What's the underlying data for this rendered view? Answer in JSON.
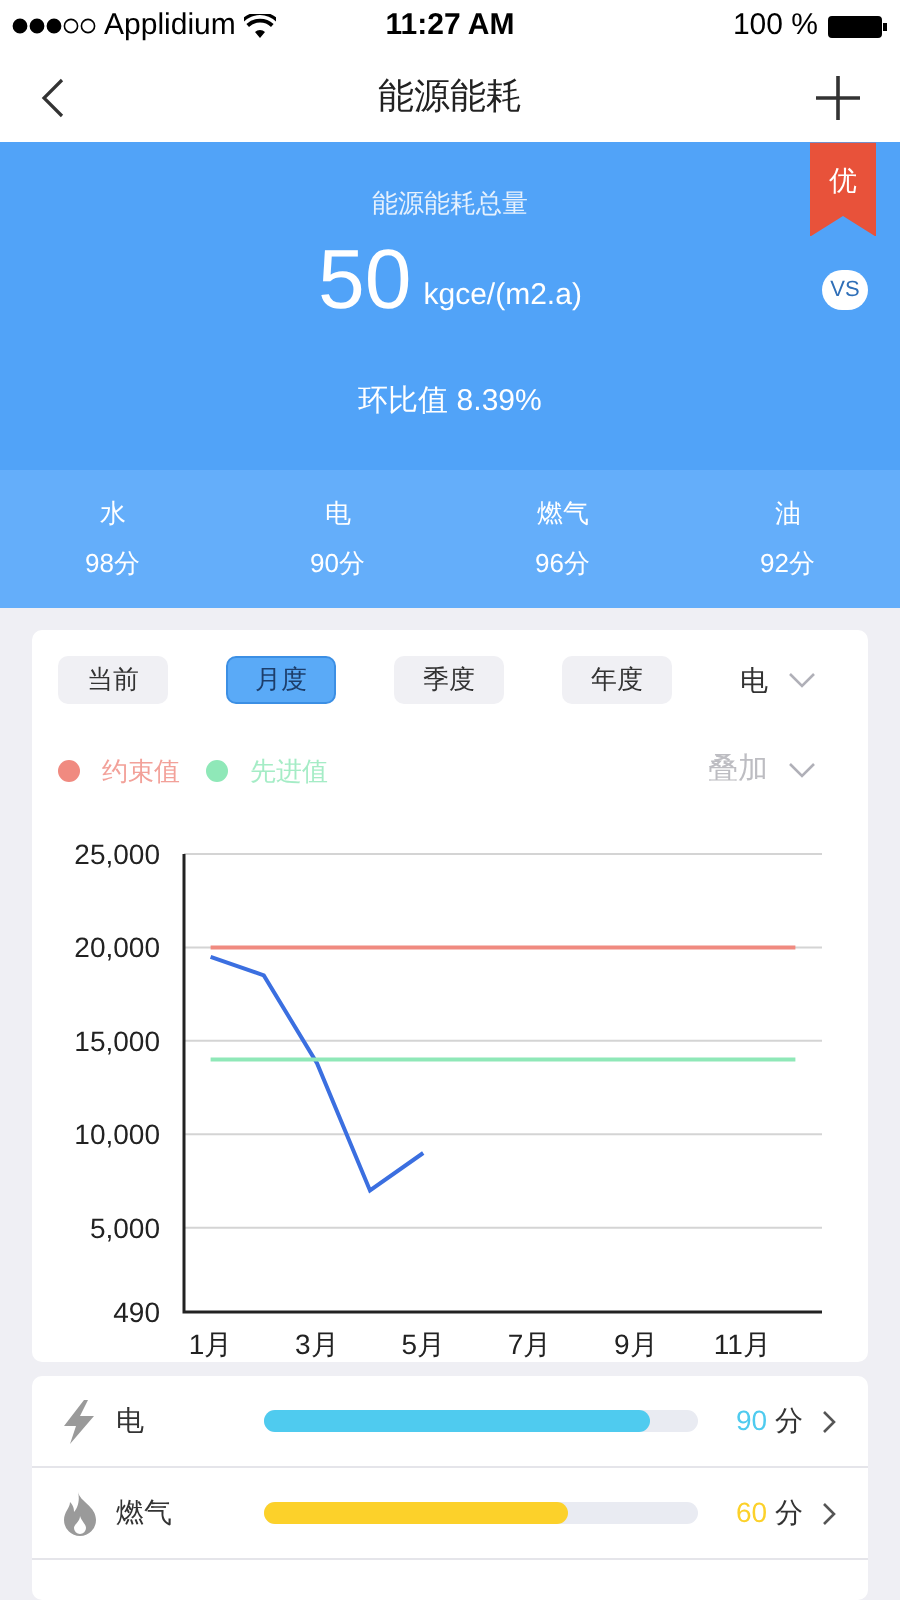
{
  "status_bar": {
    "carrier": "Applidium",
    "time": "11:27 AM",
    "battery": "100 %"
  },
  "nav": {
    "title": "能源能耗"
  },
  "summary": {
    "title": "能源能耗总量",
    "value": "50",
    "unit": "kgce/(m2.a)",
    "ratio": "环比值 8.39%",
    "badge": "优",
    "compare": "VS"
  },
  "scores": [
    {
      "label": "水",
      "value": "98分"
    },
    {
      "label": "电",
      "value": "90分"
    },
    {
      "label": "燃气",
      "value": "96分"
    },
    {
      "label": "油",
      "value": "92分"
    }
  ],
  "period_tabs": [
    {
      "label": "当前",
      "selected": false
    },
    {
      "label": "月度",
      "selected": true
    },
    {
      "label": "季度",
      "selected": false
    },
    {
      "label": "年度",
      "selected": false
    }
  ],
  "energy_select": {
    "value": "电"
  },
  "overlay_select": {
    "value": "叠加"
  },
  "chart_data": {
    "type": "line",
    "x": [
      1,
      2,
      3,
      4,
      5,
      6,
      7,
      8,
      9,
      10,
      11,
      12
    ],
    "grid": true,
    "xlim": [
      0.5,
      12.5
    ],
    "ylim": [
      490,
      25000
    ],
    "xticks": [
      {
        "value": 1,
        "label": "1月"
      },
      {
        "value": 3,
        "label": "3月"
      },
      {
        "value": 5,
        "label": "5月"
      },
      {
        "value": 7,
        "label": "7月"
      },
      {
        "value": 9,
        "label": "9月"
      },
      {
        "value": 11,
        "label": "11月"
      }
    ],
    "yticks": [
      {
        "value": 25000,
        "label": "25,000"
      },
      {
        "value": 20000,
        "label": "20,000"
      },
      {
        "value": 15000,
        "label": "15,000"
      },
      {
        "value": 10000,
        "label": "10,000"
      },
      {
        "value": 5000,
        "label": "5,000"
      },
      {
        "value": 490,
        "label": "490"
      }
    ],
    "series": [
      {
        "color": "#3b6fe0",
        "values": [
          19500,
          18500,
          13800,
          7000,
          9000,
          null,
          null,
          null,
          null,
          null,
          null,
          null
        ]
      },
      {
        "name": "约束值",
        "color": "#f08a80",
        "values": [
          20000,
          20000,
          20000,
          20000,
          20000,
          20000,
          20000,
          20000,
          20000,
          20000,
          20000,
          20000
        ]
      },
      {
        "name": "先进值",
        "color": "#8fe8b8",
        "values": [
          14000,
          14000,
          14000,
          14000,
          14000,
          14000,
          14000,
          14000,
          14000,
          14000,
          14000,
          14000
        ]
      }
    ]
  },
  "energy_rows": [
    {
      "kind": "lightning",
      "label": "电",
      "score": "90",
      "unit": "分",
      "level": 0.89,
      "color": "#4fcbef"
    },
    {
      "kind": "flame",
      "label": "燃气",
      "score": "60",
      "unit": "分",
      "level": 0.7,
      "color": "#fcd12a"
    }
  ]
}
